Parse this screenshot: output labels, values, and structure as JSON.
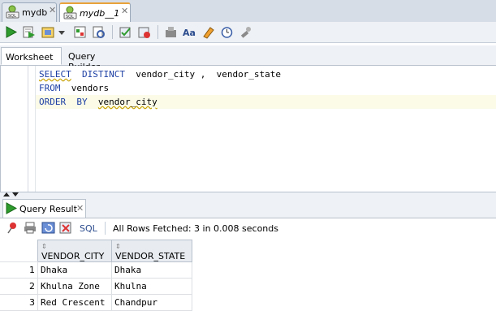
{
  "doc_tabs": [
    {
      "label": "mydb",
      "active": false
    },
    {
      "label": "mydb__1",
      "active": true
    }
  ],
  "toolbar": {
    "icons": [
      "run-statement-icon",
      "run-script-icon",
      "autotrace-icon",
      "dropdown-arrow-icon",
      "explain-plan-icon",
      "sql-tuning-advisor-icon",
      "commit-icon",
      "rollback-icon",
      "unshared-sql-icon",
      "to-upper-lower-icon",
      "clear-icon",
      "sql-history-icon",
      "tools-icon"
    ]
  },
  "subtabs": {
    "worksheet": "Worksheet",
    "query_builder": "Query Builder"
  },
  "editor": {
    "lines": [
      {
        "kw1": "SELECT",
        "kw2": "DISTINCT",
        "rest": "vendor_city ,  vendor_state"
      },
      {
        "kw1": "FROM",
        "kw2": "",
        "rest": "vendors"
      },
      {
        "kw1": "ORDER",
        "kw2": "BY",
        "rest": "vendor_city"
      }
    ]
  },
  "results": {
    "tab_label": "Query Result",
    "sql_label": "SQL",
    "status": "All Rows Fetched: 3 in 0.008 seconds",
    "columns": [
      "VENDOR_CITY",
      "VENDOR_STATE"
    ],
    "rows": [
      {
        "n": "1",
        "city": "Dhaka",
        "state": "Dhaka"
      },
      {
        "n": "2",
        "city": "Khulna Zone",
        "state": "Khulna"
      },
      {
        "n": "3",
        "city": "Red Crescent",
        "state": "Chandpur"
      }
    ]
  },
  "colors": {
    "keyword": "#1d3fa4",
    "active_tab_accent": "#e8a23a",
    "panel_bg": "#eef1f5"
  }
}
